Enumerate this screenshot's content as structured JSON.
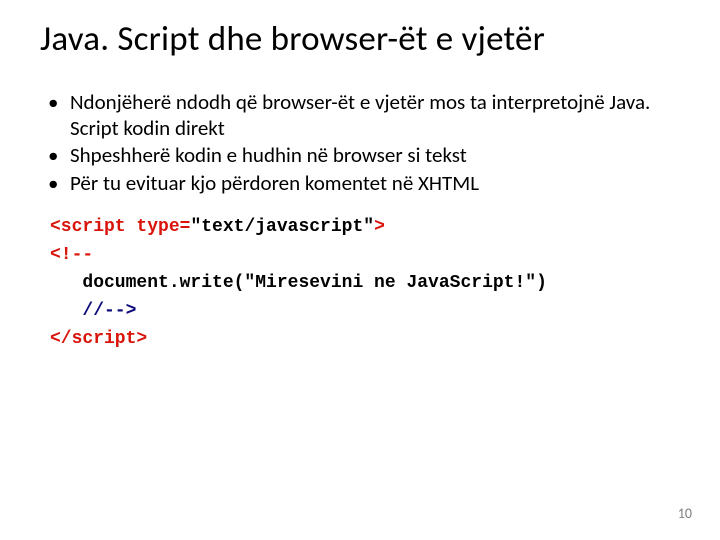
{
  "title": "Java. Script dhe browser-ët e vjetër",
  "bullets": [
    "Ndonjëherë ndodh që browser-ët e vjetër mos ta interpretojnë Java. Script kodin direkt",
    "Shpeshherë kodin e hudhin në browser si tekst",
    "Për tu evituar kjo përdoren komentet në XHTML"
  ],
  "code": {
    "l1a": "<script type=",
    "l1b": "\"text/javascript\"",
    "l1c": ">",
    "l2": "<!--",
    "l3": "   document.write(\"Miresevini ne JavaScript!\")",
    "l4": "   //-->",
    "l5": "</script>"
  },
  "page_number": "10"
}
